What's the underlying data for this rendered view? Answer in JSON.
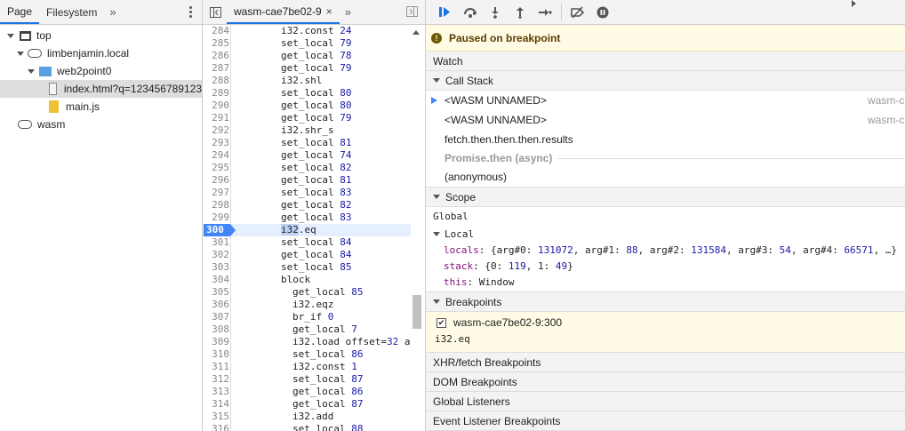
{
  "navigator": {
    "tabs": [
      {
        "label": "Page",
        "active": true
      },
      {
        "label": "Filesystem",
        "active": false
      }
    ],
    "more_label": "»",
    "tree": [
      {
        "label": "top",
        "icon": "frame-icon",
        "expanded": true,
        "depth": 0
      },
      {
        "label": "limbenjamin.local",
        "icon": "cloud-icon",
        "expanded": true,
        "depth": 1
      },
      {
        "label": "web2point0",
        "icon": "folder-icon",
        "expanded": true,
        "depth": 2
      },
      {
        "label": "index.html?q=123456789123",
        "icon": "file-icon",
        "selected": true,
        "depth": 3
      },
      {
        "label": "main.js",
        "icon": "js-file-icon",
        "depth": 3
      },
      {
        "label": "wasm",
        "icon": "cloud-icon",
        "expanded": false,
        "depth": 1
      }
    ]
  },
  "editor": {
    "tab_label": "wasm-cae7be02-9",
    "close_label": "×",
    "more_label": "»",
    "breakpoint_line": 300,
    "lines": [
      {
        "n": "284",
        "code": "i32.const ",
        "num": "24"
      },
      {
        "n": "285",
        "code": "set_local ",
        "num": "79"
      },
      {
        "n": "286",
        "code": "get_local ",
        "num": "78"
      },
      {
        "n": "287",
        "code": "get_local ",
        "num": "79"
      },
      {
        "n": "288",
        "code": "i32.shl",
        "num": ""
      },
      {
        "n": "289",
        "code": "set_local ",
        "num": "80"
      },
      {
        "n": "290",
        "code": "get_local ",
        "num": "80"
      },
      {
        "n": "291",
        "code": "get_local ",
        "num": "79"
      },
      {
        "n": "292",
        "code": "i32.shr_s",
        "num": ""
      },
      {
        "n": "293",
        "code": "set_local ",
        "num": "81"
      },
      {
        "n": "294",
        "code": "get_local ",
        "num": "74"
      },
      {
        "n": "295",
        "code": "set_local ",
        "num": "82"
      },
      {
        "n": "296",
        "code": "get_local ",
        "num": "81"
      },
      {
        "n": "297",
        "code": "set_local ",
        "num": "83"
      },
      {
        "n": "298",
        "code": "get_local ",
        "num": "82"
      },
      {
        "n": "299",
        "code": "get_local ",
        "num": "83"
      },
      {
        "n": "300",
        "code": "i32.eq",
        "num": ""
      },
      {
        "n": "301",
        "code": "set_local ",
        "num": "84"
      },
      {
        "n": "302",
        "code": "get_local ",
        "num": "84"
      },
      {
        "n": "303",
        "code": "set_local ",
        "num": "85"
      },
      {
        "n": "304",
        "code": "block",
        "num": ""
      },
      {
        "n": "305",
        "code": "get_local ",
        "num": "85",
        "indent": true
      },
      {
        "n": "306",
        "code": "i32.eqz",
        "num": "",
        "indent": true
      },
      {
        "n": "307",
        "code": "br_if ",
        "num": "0",
        "indent": true
      },
      {
        "n": "308",
        "code": "get_local ",
        "num": "7",
        "indent": true
      },
      {
        "n": "309",
        "code": "i32.load offset=",
        "num": "32",
        "tail": " a",
        "indent": true
      },
      {
        "n": "310",
        "code": "set_local ",
        "num": "86",
        "indent": true
      },
      {
        "n": "311",
        "code": "i32.const ",
        "num": "1",
        "indent": true
      },
      {
        "n": "312",
        "code": "set_local ",
        "num": "87",
        "indent": true
      },
      {
        "n": "313",
        "code": "get_local ",
        "num": "86",
        "indent": true
      },
      {
        "n": "314",
        "code": "get_local ",
        "num": "87",
        "indent": true
      },
      {
        "n": "315",
        "code": "i32.add",
        "num": "",
        "indent": true
      },
      {
        "n": "316",
        "code": "set_local ",
        "num": "88",
        "indent": true
      }
    ]
  },
  "debugger": {
    "paused_message": "Paused on breakpoint",
    "sections": {
      "watch": "Watch",
      "call_stack": "Call Stack",
      "scope": "Scope",
      "breakpoints": "Breakpoints",
      "xhr": "XHR/fetch Breakpoints",
      "dom": "DOM Breakpoints",
      "global_listeners": "Global Listeners",
      "event_listeners": "Event Listener Breakpoints"
    },
    "call_stack": [
      {
        "name": "<WASM UNNAMED>",
        "location": "wasm-c",
        "current": true
      },
      {
        "name": "<WASM UNNAMED>",
        "location": "wasm-c",
        "current": false
      },
      {
        "name": "fetch.then.then.then.results",
        "location": "",
        "current": false
      }
    ],
    "async_label": "Promise.then (async)",
    "anonymous_frame": "(anonymous)",
    "scope": {
      "global_label": "Global",
      "local_label": "Local",
      "locals_key": "locals",
      "locals_value": "{arg#0: 131072, arg#1: 88, arg#2: 131584, arg#3: 54, arg#4: 66571, …}",
      "stack_key": "stack",
      "stack_value": "{0: 119, 1: 49}",
      "this_key": "this",
      "this_value": "Window"
    },
    "breakpoint": {
      "name": "wasm-cae7be02-9:300",
      "code": "i32.eq",
      "checked": true
    }
  },
  "colors": {
    "accent": "#1a73e8",
    "breakpoint": "#4285f4",
    "paused_bg": "#fffbe5"
  }
}
